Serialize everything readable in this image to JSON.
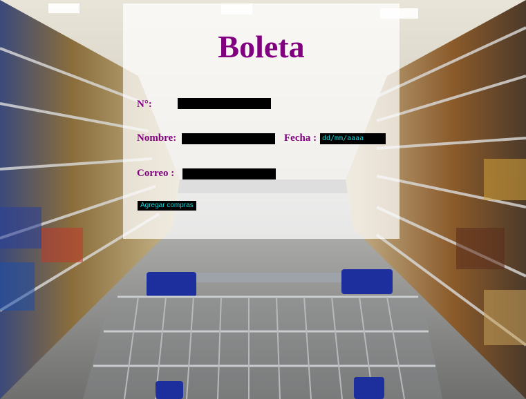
{
  "form": {
    "title": "Boleta",
    "number_label": "N°:",
    "number_value": "",
    "name_label": "Nombre:",
    "name_value": "",
    "date_label": "Fecha :",
    "date_placeholder": "dd/mm/aaaa",
    "email_label": "Correo :",
    "email_value": "",
    "add_button_label": "Agregar compras"
  },
  "colors": {
    "title": "#800080",
    "labels": "#800080",
    "field_background": "#000000",
    "field_text": "#19d5d9",
    "panel": "rgba(255,255,255,0.72)"
  },
  "background": {
    "image": "supermarket-aisle-with-shopping-cart"
  }
}
